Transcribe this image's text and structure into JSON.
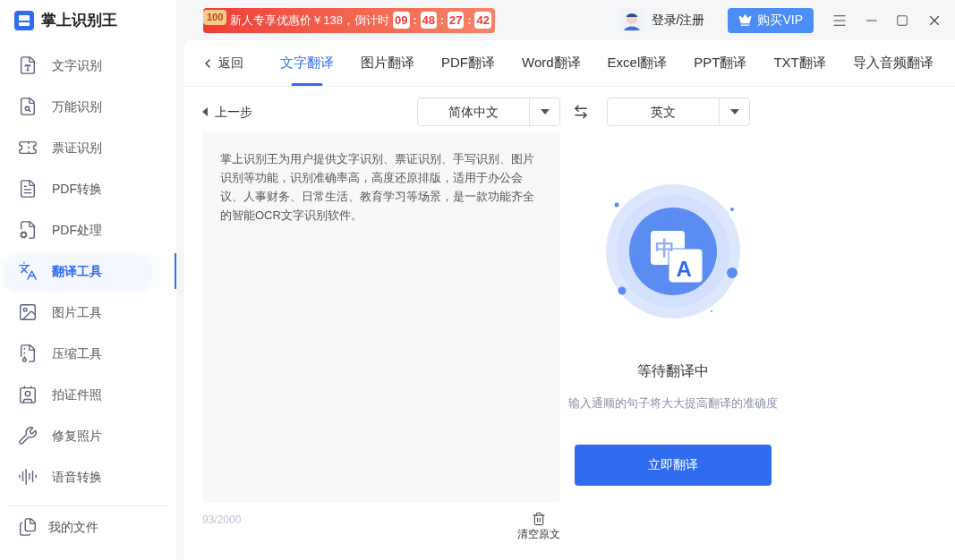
{
  "app": {
    "name": "掌上识别王"
  },
  "promo": {
    "badge": "100",
    "text": "新人专享优惠价￥138，倒计时",
    "countdown": [
      "09",
      "48",
      "27",
      "42"
    ],
    "separator": ":"
  },
  "account": {
    "login": "登录/注册",
    "vip": "购买VIP"
  },
  "sidebar": {
    "items": [
      {
        "label": "文字识别",
        "selected": false
      },
      {
        "label": "万能识别",
        "selected": false
      },
      {
        "label": "票证识别",
        "selected": false
      },
      {
        "label": "PDF转换",
        "selected": false
      },
      {
        "label": "PDF处理",
        "selected": false
      },
      {
        "label": "翻译工具",
        "selected": true
      },
      {
        "label": "图片工具",
        "selected": false
      },
      {
        "label": "压缩工具",
        "selected": false
      },
      {
        "label": "拍证件照",
        "selected": false
      },
      {
        "label": "修复照片",
        "selected": false
      },
      {
        "label": "语音转换",
        "selected": false
      }
    ],
    "footer": "我的文件"
  },
  "nav": {
    "back": "返回",
    "tabs": [
      {
        "label": "文字翻译",
        "selected": true
      },
      {
        "label": "图片翻译",
        "selected": false
      },
      {
        "label": "PDF翻译",
        "selected": false
      },
      {
        "label": "Word翻译",
        "selected": false
      },
      {
        "label": "Excel翻译",
        "selected": false
      },
      {
        "label": "PPT翻译",
        "selected": false
      },
      {
        "label": "TXT翻译",
        "selected": false
      },
      {
        "label": "导入音频翻译",
        "selected": false
      }
    ]
  },
  "source": {
    "prev": "上一步",
    "language": "简体中文",
    "text": "掌上识别王为用户提供文字识别、票证识别、手写识别、图片识别等功能，识别准确率高，高度还原排版，适用于办公会议、人事财务、日常生活、教育学习等场景，是一款功能齐全的智能OCR文字识别软件。",
    "count": "93/2000",
    "clear": "清空原文"
  },
  "target": {
    "language": "英文",
    "glyphs": [
      "中",
      "A"
    ],
    "status": "等待翻译中",
    "hint": "输入通顺的句子将大大提高翻译的准确度",
    "button": "立即翻译"
  }
}
